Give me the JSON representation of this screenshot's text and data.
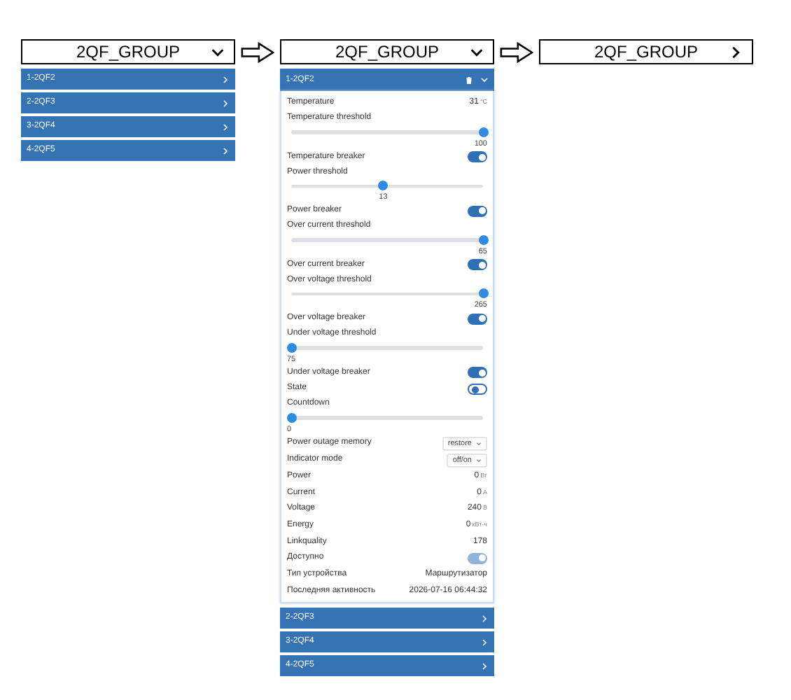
{
  "stages": [
    {
      "title": "2QF_GROUP",
      "expanded": true,
      "devices": [
        {
          "name": "1-2QF2",
          "expanded": false
        },
        {
          "name": "2-2QF3",
          "expanded": false
        },
        {
          "name": "3-2QF4",
          "expanded": false
        },
        {
          "name": "4-2QF5",
          "expanded": false
        }
      ]
    },
    {
      "title": "2QF_GROUP",
      "expanded": true,
      "devices": [
        {
          "name": "1-2QF2",
          "expanded": true,
          "rows": [
            {
              "kind": "reading",
              "label": "Temperature",
              "value": "31",
              "unit": "°C"
            },
            {
              "kind": "slider",
              "label": "Temperature threshold",
              "level": 1,
              "reading": "100"
            },
            {
              "kind": "toggle",
              "label": "Temperature breaker",
              "on": true,
              "disabled": false
            },
            {
              "kind": "slider",
              "label": "Power threshold",
              "level": 0.48,
              "reading": "13"
            },
            {
              "kind": "toggle",
              "label": "Power breaker",
              "on": true,
              "disabled": false
            },
            {
              "kind": "slider",
              "label": "Over current threshold",
              "level": 1,
              "reading": "65"
            },
            {
              "kind": "toggle",
              "label": "Over current breaker",
              "on": true,
              "disabled": false
            },
            {
              "kind": "slider",
              "label": "Over voltage threshold",
              "level": 1,
              "reading": "265"
            },
            {
              "kind": "toggle",
              "label": "Over voltage breaker",
              "on": true,
              "disabled": false
            },
            {
              "kind": "slider",
              "label": "Under voltage threshold",
              "level": 0,
              "reading": "75"
            },
            {
              "kind": "toggle",
              "label": "Under voltage breaker",
              "on": true,
              "disabled": false
            },
            {
              "kind": "toggle",
              "label": "State",
              "on": false,
              "disabled": false
            },
            {
              "kind": "slider",
              "label": "Countdown",
              "level": 0,
              "reading": "0"
            },
            {
              "kind": "select",
              "label": "Power outage memory",
              "value": "restore"
            },
            {
              "kind": "select",
              "label": "Indicator mode",
              "value": "off/on"
            },
            {
              "kind": "reading",
              "label": "Power",
              "value": "0",
              "unit": "Вт"
            },
            {
              "kind": "reading",
              "label": "Current",
              "value": "0",
              "unit": "А"
            },
            {
              "kind": "reading",
              "label": "Voltage",
              "value": "240",
              "unit": "В"
            },
            {
              "kind": "reading",
              "label": "Energy",
              "value": "0",
              "unit": "кВт·ч"
            },
            {
              "kind": "reading",
              "label": "Linkquality",
              "value": "178"
            },
            {
              "kind": "toggle",
              "label": "Доступно",
              "on": true,
              "disabled": true
            },
            {
              "kind": "reading",
              "label": "Тип устройства",
              "value": "Маршрутизатор"
            },
            {
              "kind": "reading",
              "label": "Последняя активность",
              "value": "2026-07-16 06:44:32"
            }
          ]
        },
        {
          "name": "2-2QF3",
          "expanded": false
        },
        {
          "name": "3-2QF4",
          "expanded": false
        },
        {
          "name": "4-2QF5",
          "expanded": false
        }
      ]
    },
    {
      "title": "2QF_GROUP",
      "expanded": false
    }
  ]
}
